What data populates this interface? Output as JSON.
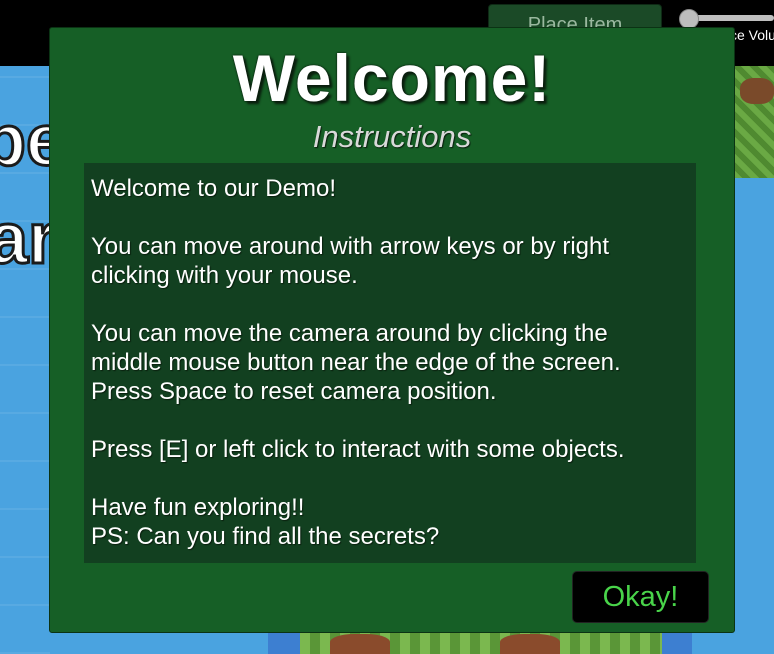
{
  "topbar": {
    "place_item_label": "Place Item",
    "volume_label": "ce Volu",
    "volume_value": 0.0
  },
  "background": {
    "text_line1": "pe",
    "text_line2": "ar"
  },
  "dialog": {
    "title": "Welcome!",
    "subtitle": "Instructions",
    "lines": [
      "Welcome to our Demo!",
      "You can move around with arrow keys or by right",
      "clicking with your mouse.",
      "You can move the camera around by clicking the",
      "middle mouse button near the edge of the screen.",
      "Press Space to reset camera position.",
      "Press [E] or left click to interact with some objects.",
      "Have fun exploring!!",
      "PS: Can you find all the secrets?"
    ],
    "okay_label": "Okay!"
  },
  "colors": {
    "dialog_bg": "#165f26",
    "panel_bg": "#124020",
    "okay_text": "#49d44a",
    "water": "#4aa3e0"
  }
}
